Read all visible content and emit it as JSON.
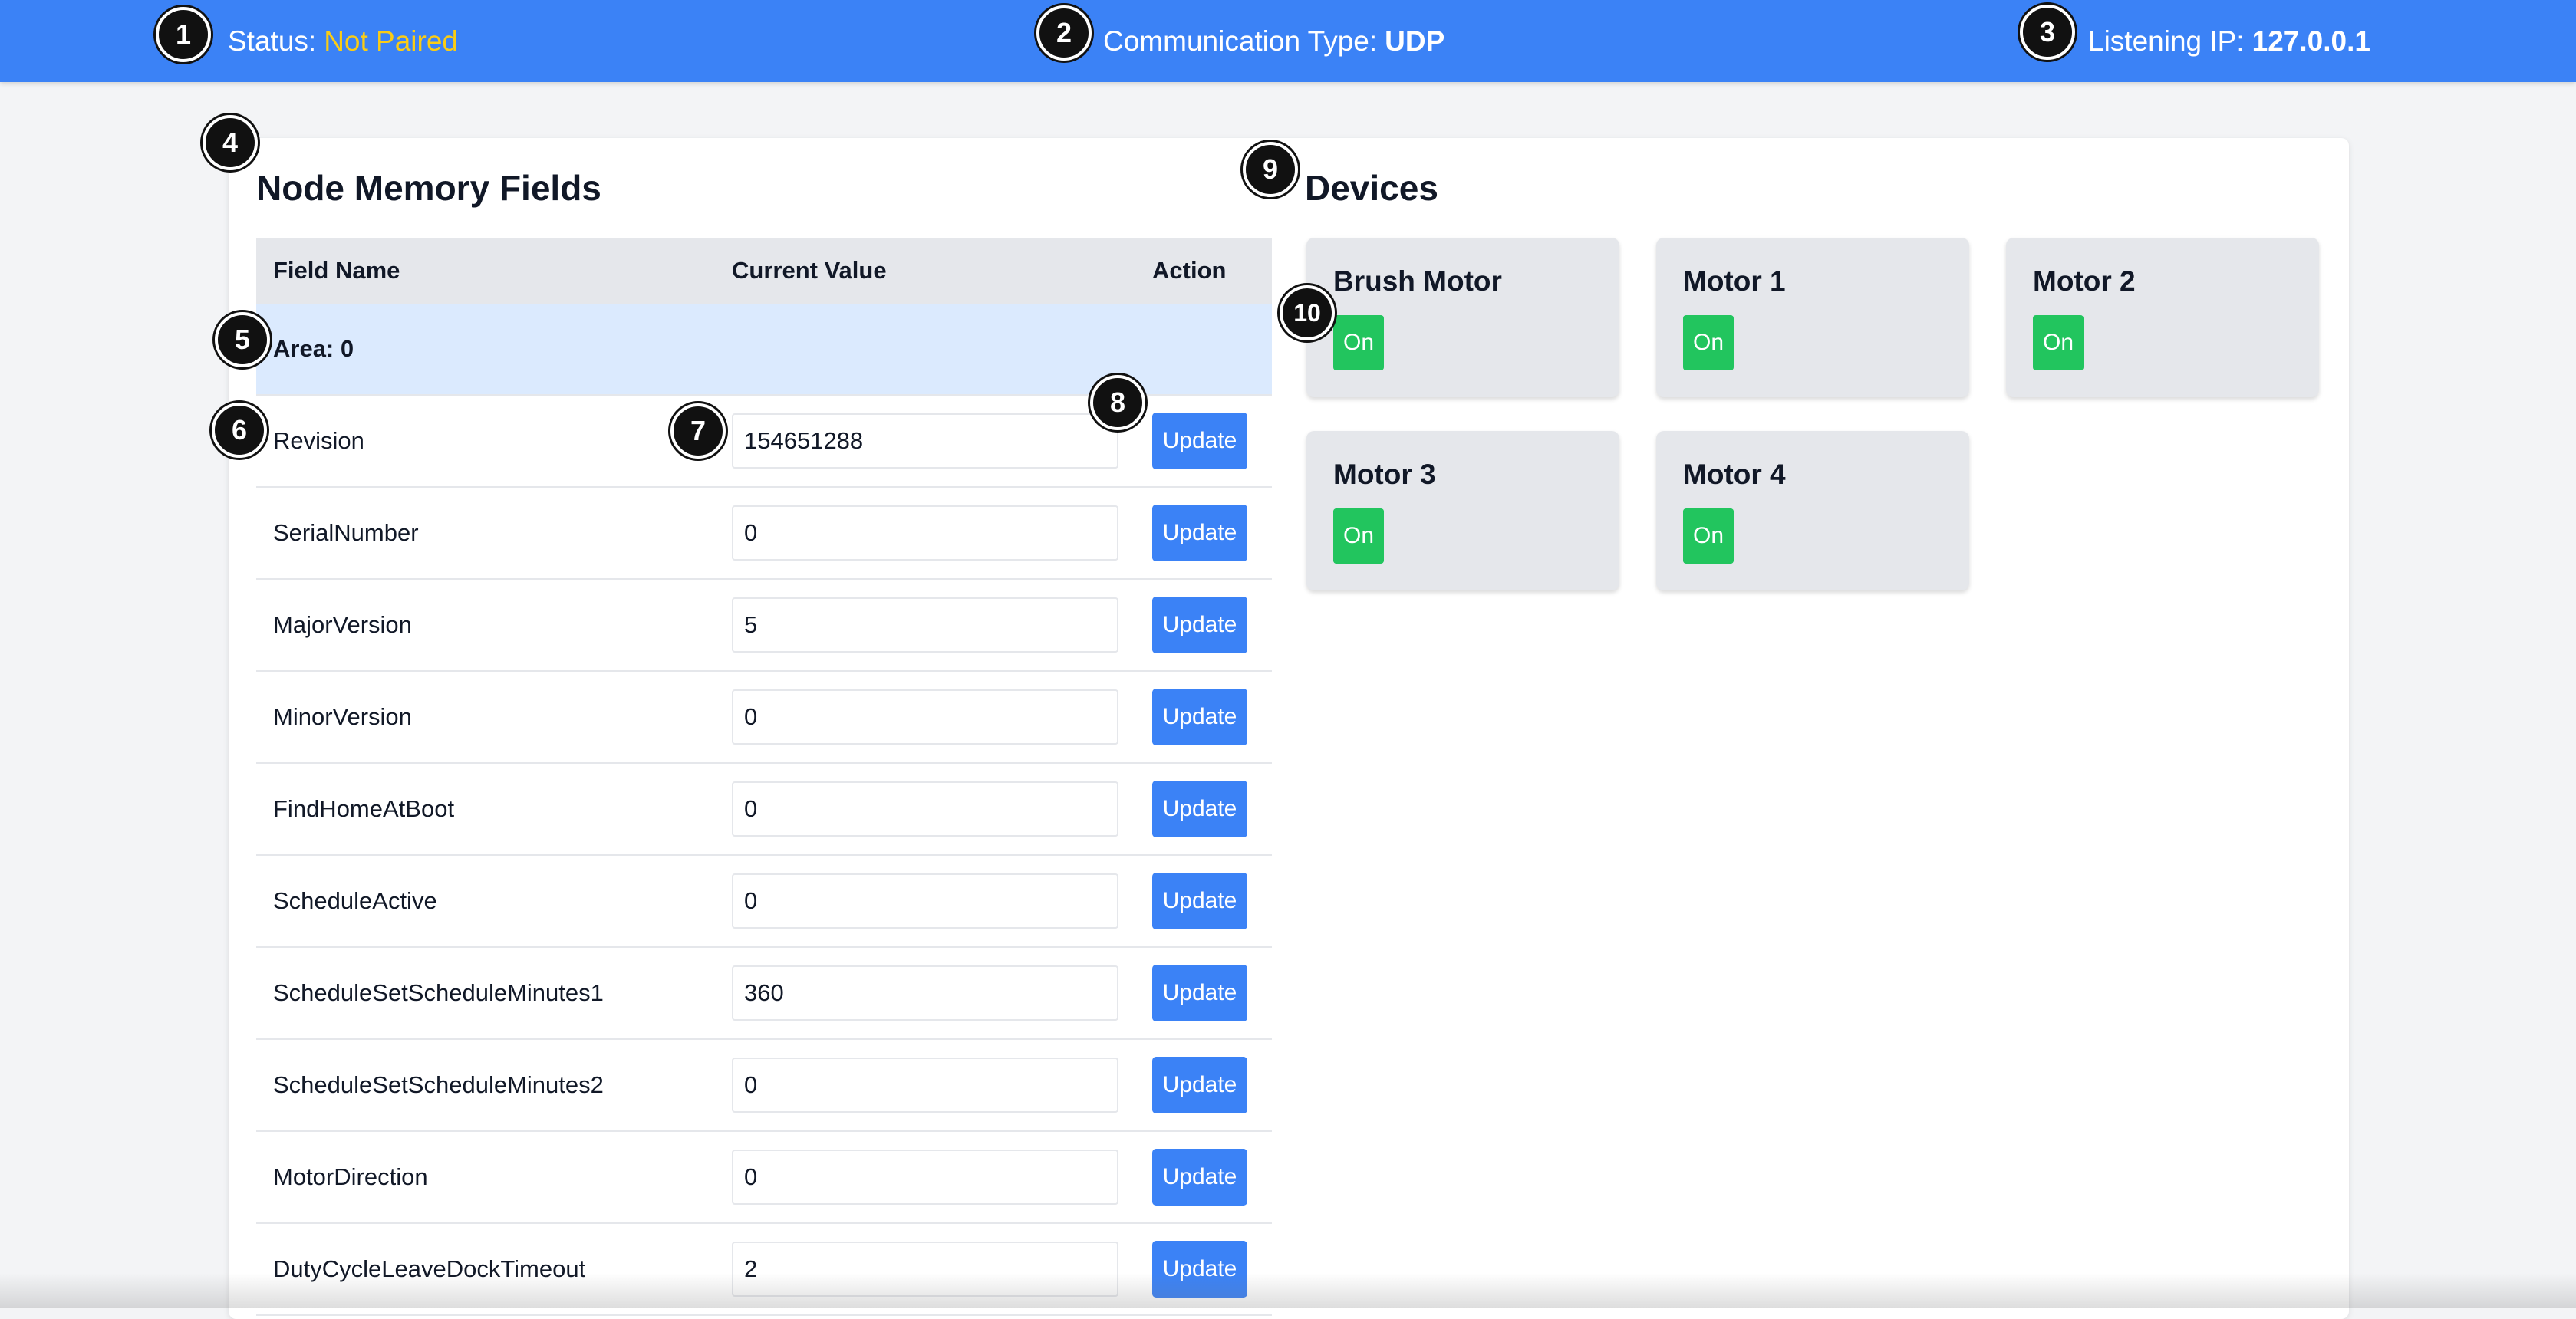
{
  "header": {
    "status_label": "Status:",
    "status_value": "Not Paired",
    "comm_label": "Communication Type:",
    "comm_value": "UDP",
    "ip_label": "Listening IP:",
    "ip_value": "127.0.0.1"
  },
  "markers": [
    "1",
    "2",
    "3",
    "4",
    "5",
    "6",
    "7",
    "8",
    "9",
    "10"
  ],
  "memory": {
    "title": "Node Memory Fields",
    "columns": [
      "Field Name",
      "Current Value",
      "Action"
    ],
    "area_label": "Area: 0",
    "update_label": "Update",
    "rows": [
      {
        "name": "Revision",
        "value": "154651288"
      },
      {
        "name": "SerialNumber",
        "value": "0"
      },
      {
        "name": "MajorVersion",
        "value": "5"
      },
      {
        "name": "MinorVersion",
        "value": "0"
      },
      {
        "name": "FindHomeAtBoot",
        "value": "0"
      },
      {
        "name": "ScheduleActive",
        "value": "0"
      },
      {
        "name": "ScheduleSetScheduleMinutes1",
        "value": "360"
      },
      {
        "name": "ScheduleSetScheduleMinutes2",
        "value": "0"
      },
      {
        "name": "MotorDirection",
        "value": "0"
      },
      {
        "name": "DutyCycleLeaveDockTimeout",
        "value": "2"
      }
    ]
  },
  "devices": {
    "title": "Devices",
    "items": [
      {
        "name": "Brush Motor",
        "state": "On"
      },
      {
        "name": "Motor 1",
        "state": "On"
      },
      {
        "name": "Motor 2",
        "state": "On"
      },
      {
        "name": "Motor 3",
        "state": "On"
      },
      {
        "name": "Motor 4",
        "state": "On"
      }
    ]
  },
  "colors": {
    "header_bg": "#3b82f6",
    "status_warn": "#facc15",
    "button_blue": "#3b82f6",
    "on_green": "#22c55e",
    "area_bg": "#dbeafe",
    "area_text": "#1e40af"
  }
}
